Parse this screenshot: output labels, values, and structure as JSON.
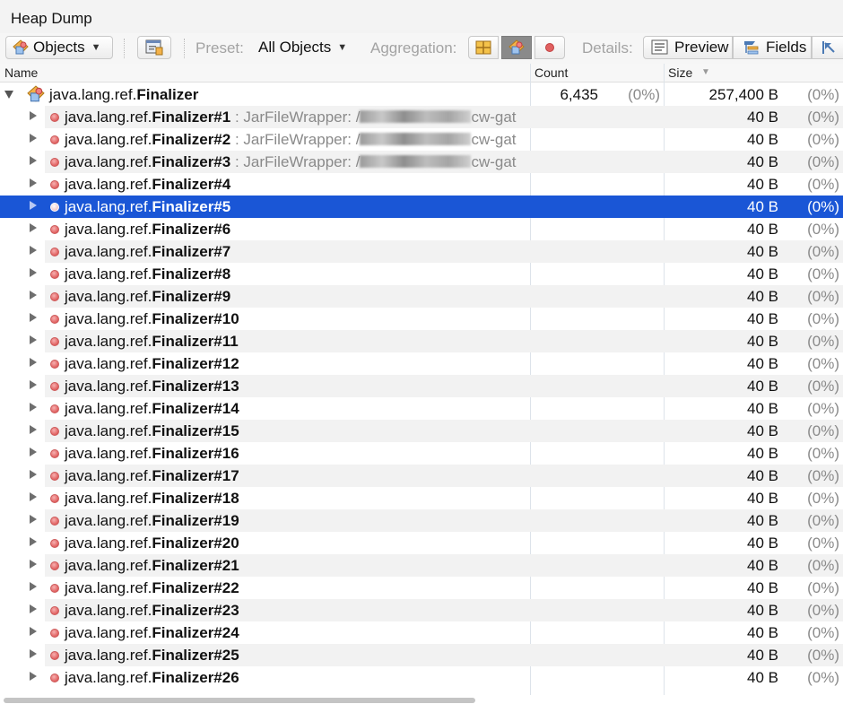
{
  "window": {
    "title": "Heap Dump"
  },
  "toolbar": {
    "objects_label": "Objects",
    "preset_label": "Preset:",
    "preset_value": "All Objects",
    "aggregation_label": "Aggregation:",
    "details_label": "Details:",
    "preview_label": "Preview",
    "fields_label": "Fields"
  },
  "columns": {
    "name": "Name",
    "count": "Count",
    "size": "Size"
  },
  "root": {
    "prefix": "java.lang.ref.",
    "class": "Finalizer",
    "count": "6,435",
    "count_pct": "(0%)",
    "size": "257,400 B",
    "size_pct": "(0%)"
  },
  "rows": [
    {
      "prefix": "java.lang.ref.",
      "name": "Finalizer#1",
      "desc": " : JarFileWrapper: /",
      "tail": "cw-gat",
      "size": "40 B",
      "pct": "(0%)"
    },
    {
      "prefix": "java.lang.ref.",
      "name": "Finalizer#2",
      "desc": " : JarFileWrapper: /",
      "tail": "cw-gat",
      "size": "40 B",
      "pct": "(0%)"
    },
    {
      "prefix": "java.lang.ref.",
      "name": "Finalizer#3",
      "desc": " : JarFileWrapper: /",
      "tail": "cw-gat",
      "size": "40 B",
      "pct": "(0%)"
    },
    {
      "prefix": "java.lang.ref.",
      "name": "Finalizer#4",
      "size": "40 B",
      "pct": "(0%)"
    },
    {
      "prefix": "java.lang.ref.",
      "name": "Finalizer#5",
      "size": "40 B",
      "pct": "(0%)"
    },
    {
      "prefix": "java.lang.ref.",
      "name": "Finalizer#6",
      "size": "40 B",
      "pct": "(0%)"
    },
    {
      "prefix": "java.lang.ref.",
      "name": "Finalizer#7",
      "size": "40 B",
      "pct": "(0%)"
    },
    {
      "prefix": "java.lang.ref.",
      "name": "Finalizer#8",
      "size": "40 B",
      "pct": "(0%)"
    },
    {
      "prefix": "java.lang.ref.",
      "name": "Finalizer#9",
      "size": "40 B",
      "pct": "(0%)"
    },
    {
      "prefix": "java.lang.ref.",
      "name": "Finalizer#10",
      "size": "40 B",
      "pct": "(0%)"
    },
    {
      "prefix": "java.lang.ref.",
      "name": "Finalizer#11",
      "size": "40 B",
      "pct": "(0%)"
    },
    {
      "prefix": "java.lang.ref.",
      "name": "Finalizer#12",
      "size": "40 B",
      "pct": "(0%)"
    },
    {
      "prefix": "java.lang.ref.",
      "name": "Finalizer#13",
      "size": "40 B",
      "pct": "(0%)"
    },
    {
      "prefix": "java.lang.ref.",
      "name": "Finalizer#14",
      "size": "40 B",
      "pct": "(0%)"
    },
    {
      "prefix": "java.lang.ref.",
      "name": "Finalizer#15",
      "size": "40 B",
      "pct": "(0%)"
    },
    {
      "prefix": "java.lang.ref.",
      "name": "Finalizer#16",
      "size": "40 B",
      "pct": "(0%)"
    },
    {
      "prefix": "java.lang.ref.",
      "name": "Finalizer#17",
      "size": "40 B",
      "pct": "(0%)"
    },
    {
      "prefix": "java.lang.ref.",
      "name": "Finalizer#18",
      "size": "40 B",
      "pct": "(0%)"
    },
    {
      "prefix": "java.lang.ref.",
      "name": "Finalizer#19",
      "size": "40 B",
      "pct": "(0%)"
    },
    {
      "prefix": "java.lang.ref.",
      "name": "Finalizer#20",
      "size": "40 B",
      "pct": "(0%)"
    },
    {
      "prefix": "java.lang.ref.",
      "name": "Finalizer#21",
      "size": "40 B",
      "pct": "(0%)"
    },
    {
      "prefix": "java.lang.ref.",
      "name": "Finalizer#22",
      "size": "40 B",
      "pct": "(0%)"
    },
    {
      "prefix": "java.lang.ref.",
      "name": "Finalizer#23",
      "size": "40 B",
      "pct": "(0%)"
    },
    {
      "prefix": "java.lang.ref.",
      "name": "Finalizer#24",
      "size": "40 B",
      "pct": "(0%)"
    },
    {
      "prefix": "java.lang.ref.",
      "name": "Finalizer#25",
      "size": "40 B",
      "pct": "(0%)"
    },
    {
      "prefix": "java.lang.ref.",
      "name": "Finalizer#26",
      "size": "40 B",
      "pct": "(0%)"
    }
  ],
  "selected_row": "Finalizer#5",
  "colors": {
    "selection": "#1a56d6",
    "stripe": "#f2f2f2",
    "instance_dot": "#e06060"
  }
}
